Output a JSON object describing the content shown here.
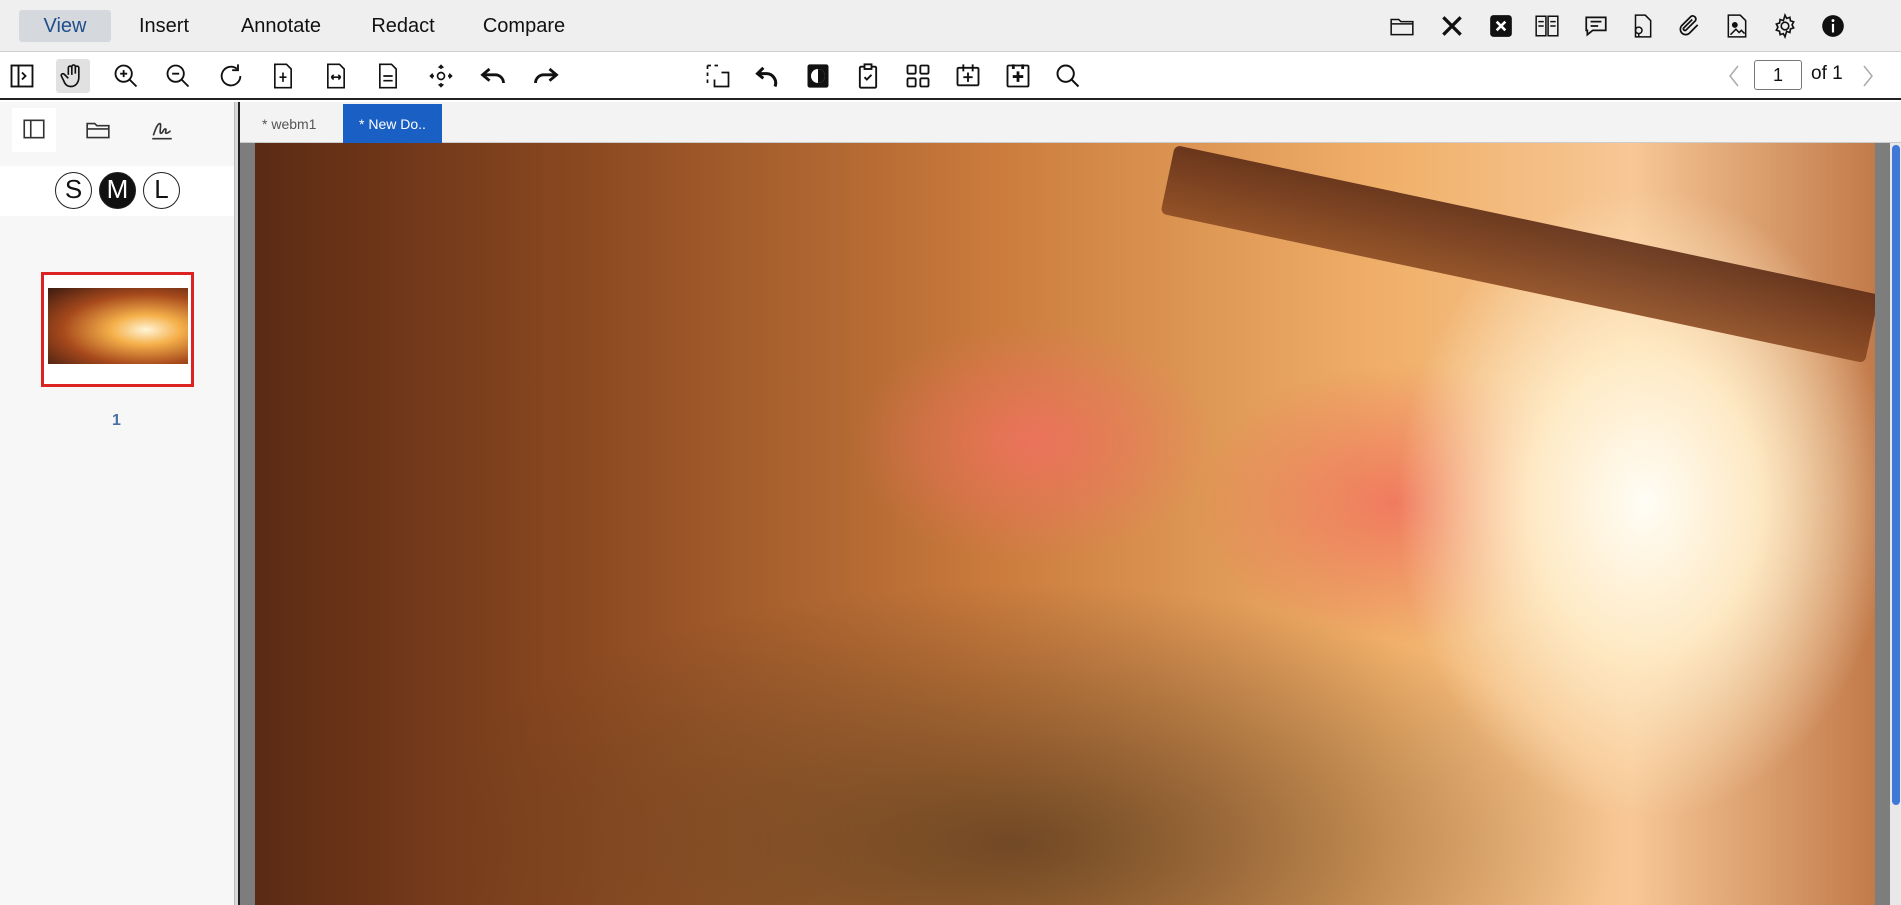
{
  "menu": {
    "tabs": [
      {
        "label": "View",
        "active": true
      },
      {
        "label": "Insert"
      },
      {
        "label": "Annotate"
      },
      {
        "label": "Redact"
      },
      {
        "label": "Compare"
      }
    ],
    "right_icons": [
      "open-folder-icon",
      "close-x-icon",
      "close-box-icon",
      "compare-pages-icon",
      "comment-icon",
      "file-certificate-icon",
      "attachment-icon",
      "image-document-icon",
      "settings-gear-icon",
      "info-icon"
    ]
  },
  "toolbar": {
    "tools": [
      "toggle-sidebar-icon",
      "pan-hand-icon",
      "zoom-in-icon",
      "zoom-out-icon",
      "rotate-icon",
      "fit-page-icon",
      "fit-width-icon",
      "single-page-icon",
      "fit-selection-icon",
      "undo-icon",
      "redo-icon",
      "select-area-icon",
      "rotate-back-icon",
      "contrast-icon",
      "clipboard-check-icon",
      "grid-icon",
      "insert-page-icon",
      "add-page-icon",
      "search-icon"
    ],
    "page_number": "1",
    "page_of": "of 1"
  },
  "sidebar": {
    "tabs": [
      "panel-icon",
      "folder-icon",
      "signature-icon"
    ],
    "sizes": [
      {
        "label": "S"
      },
      {
        "label": "M",
        "active": true
      },
      {
        "label": "L"
      }
    ],
    "thumbnail_label": "1"
  },
  "doc_tabs": [
    {
      "label": "* webm1"
    },
    {
      "label": "* New Do..",
      "active": true
    }
  ],
  "colors": {
    "accent": "#1a5fc3",
    "thumb_border": "#dd2222",
    "active_menu_bg": "#d5d9de"
  }
}
